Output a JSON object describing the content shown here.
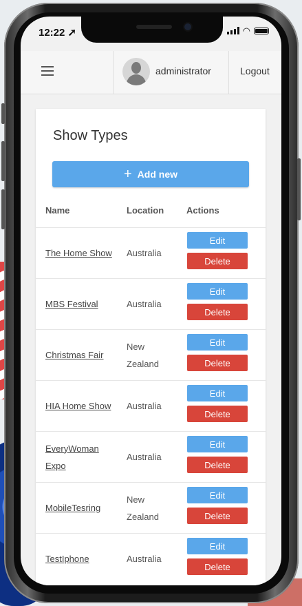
{
  "status_bar": {
    "time": "12:22 ➚"
  },
  "header": {
    "username": "administrator",
    "logout_label": "Logout"
  },
  "page": {
    "title": "Show Types",
    "add_label": "Add new",
    "columns": {
      "name": "Name",
      "location": "Location",
      "actions": "Actions"
    }
  },
  "rows": [
    {
      "name": "The Home Show",
      "location": "Australia",
      "edit": "Edit",
      "delete": "Delete"
    },
    {
      "name": "MBS Festival",
      "location": "Australia",
      "edit": "Edit",
      "delete": "Delete"
    },
    {
      "name": "Christmas Fair",
      "location": "New Zealand",
      "edit": "Edit",
      "delete": "Delete"
    },
    {
      "name": "HIA Home Show",
      "location": "Australia",
      "edit": "Edit",
      "delete": "Delete"
    },
    {
      "name": "EveryWoman Expo",
      "location": "Australia",
      "edit": "Edit",
      "delete": "Delete"
    },
    {
      "name": "MobileTesring",
      "location": "New Zealand",
      "edit": "Edit",
      "delete": "Delete"
    },
    {
      "name": "TestIphone",
      "location": "Australia",
      "edit": "Edit",
      "delete": "Delete"
    }
  ],
  "colors": {
    "primary": "#5aa7ea",
    "danger": "#d8453a"
  }
}
